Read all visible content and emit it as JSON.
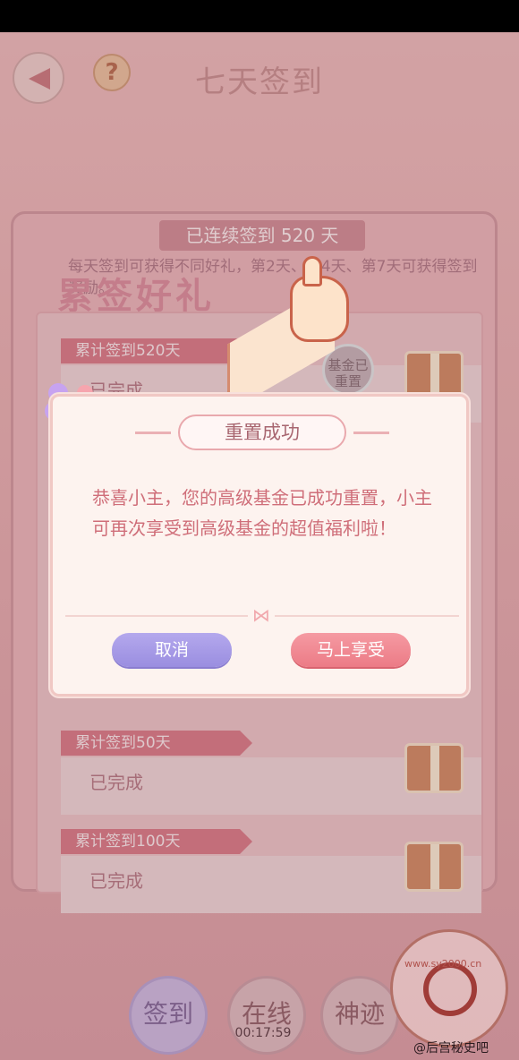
{
  "header": {
    "title": "七天签到",
    "help": "?"
  },
  "panel": {
    "streak": "已连续签到 520 天",
    "desc": "每天签到可获得不同好礼，第2天、第4天、第7天可获得签到奖励。",
    "title": "累签好礼"
  },
  "rows": [
    {
      "tag": "累计签到520天",
      "status": "已完成",
      "badge": "基金已重置"
    },
    {
      "tag": "累计签到50天",
      "status": "已完成"
    },
    {
      "tag": "累计签到100天",
      "status": "已完成"
    }
  ],
  "modal": {
    "title": "重置成功",
    "message": "恭喜小主，您的高级基金已成功重置，小主可再次享受到高级基金的超值福利啦！",
    "cancel": "取消",
    "confirm": "马上享受"
  },
  "nav": {
    "sign": "签到",
    "online": "在线",
    "online_timer": "00:17:59",
    "miracle": "神迹"
  },
  "watermark": {
    "site": "www.sy2000.cn",
    "weibo": "@后宫秘史吧"
  },
  "colors": {
    "accent": "#ec7b86",
    "cancel": "#9a8ee0"
  }
}
